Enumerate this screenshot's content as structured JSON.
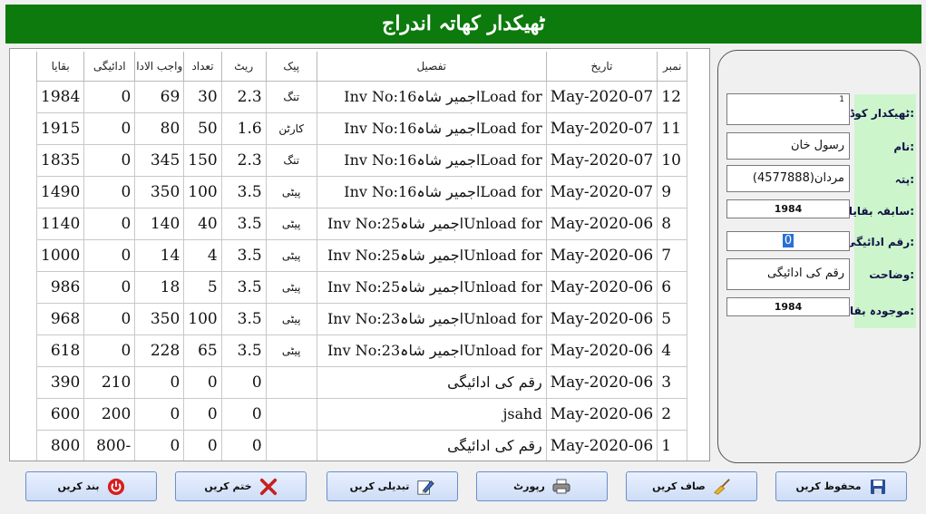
{
  "title": "ٹھیکدار کھاتہ اندراج",
  "grid": {
    "headers": {
      "no": "نمبر",
      "date": "تاریخ",
      "detail": "تفصیل",
      "pack": "پیک",
      "rate": "ریٹ",
      "qty": "تعداد",
      "due": "واجب الادا",
      "paid": "ادائیگی",
      "balance": "بقایا"
    },
    "rows": [
      {
        "no": "12",
        "date": "May-2020-07",
        "detail": "Inv No:16اجمیر شاہLoad for",
        "pack": "تنگ",
        "rate": "2.3",
        "qty": "30",
        "due": "69",
        "paid": "0",
        "balance": "1984"
      },
      {
        "no": "11",
        "date": "May-2020-07",
        "detail": "Inv No:16اجمیر شاہLoad for",
        "pack": "کارٹن",
        "rate": "1.6",
        "qty": "50",
        "due": "80",
        "paid": "0",
        "balance": "1915"
      },
      {
        "no": "10",
        "date": "May-2020-07",
        "detail": "Inv No:16اجمیر شاہLoad for",
        "pack": "تنگ",
        "rate": "2.3",
        "qty": "150",
        "due": "345",
        "paid": "0",
        "balance": "1835"
      },
      {
        "no": "9",
        "date": "May-2020-07",
        "detail": "Inv No:16اجمیر شاہLoad for",
        "pack": "پیٹی",
        "rate": "3.5",
        "qty": "100",
        "due": "350",
        "paid": "0",
        "balance": "1490"
      },
      {
        "no": "8",
        "date": "May-2020-06",
        "detail": "Inv No:25اجمیر شاہUnload for",
        "pack": "پیٹی",
        "rate": "3.5",
        "qty": "40",
        "due": "140",
        "paid": "0",
        "balance": "1140"
      },
      {
        "no": "7",
        "date": "May-2020-06",
        "detail": "Inv No:25اجمیر شاہUnload for",
        "pack": "پیٹی",
        "rate": "3.5",
        "qty": "4",
        "due": "14",
        "paid": "0",
        "balance": "1000"
      },
      {
        "no": "6",
        "date": "May-2020-06",
        "detail": "Inv No:25اجمیر شاہUnload for",
        "pack": "پیٹی",
        "rate": "3.5",
        "qty": "5",
        "due": "18",
        "paid": "0",
        "balance": "986"
      },
      {
        "no": "5",
        "date": "May-2020-06",
        "detail": "Inv No:23اجمیر شاہUnload for",
        "pack": "پیٹی",
        "rate": "3.5",
        "qty": "100",
        "due": "350",
        "paid": "0",
        "balance": "968"
      },
      {
        "no": "4",
        "date": "May-2020-06",
        "detail": "Inv No:23اجمیر شاہUnload for",
        "pack": "پیٹی",
        "rate": "3.5",
        "qty": "65",
        "due": "228",
        "paid": "0",
        "balance": "618"
      },
      {
        "no": "3",
        "date": "May-2020-06",
        "detail": "رقم کی ادائیگی",
        "pack": "",
        "rate": "0",
        "qty": "0",
        "due": "0",
        "paid": "210",
        "balance": "390"
      },
      {
        "no": "2",
        "date": "May-2020-06",
        "detail": "jsahd",
        "pack": "",
        "rate": "0",
        "qty": "0",
        "due": "0",
        "paid": "200",
        "balance": "600"
      },
      {
        "no": "1",
        "date": "May-2020-06",
        "detail": "رقم کی ادائیگی",
        "pack": "",
        "rate": "0",
        "qty": "0",
        "due": "0",
        "paid": "800-",
        "balance": "800"
      }
    ]
  },
  "form": {
    "labels": {
      "code": "ٹھیکدار کوڈ:",
      "name": "نام:",
      "address": "پتہ:",
      "prev_balance": "سابقہ بقایا:",
      "payment": "رقم ادائیگی:",
      "explanation": "وضاحت:",
      "current_balance": "موجودہ بقایا:"
    },
    "values": {
      "code": "1",
      "name": "رسول خان",
      "address": "مردان(4577888)",
      "prev_balance": "1984",
      "payment": "0",
      "explanation": "رقم کی ادائیگی",
      "current_balance": "1984"
    }
  },
  "buttons": {
    "save": "محفوظ کریں",
    "clear": "صاف کریں",
    "report": "رپورٹ",
    "edit": "تبدیلی کریں",
    "delete": "ختم کریں",
    "close": "بند کریں"
  },
  "colors": {
    "title_bar": "#0c7a0c",
    "label_panel": "#ccf5cc",
    "close_icon": "#d81e1e",
    "delete_icon": "#c62020"
  },
  "icons": {
    "save": "floppy-disk-icon",
    "clear": "broom-icon",
    "report": "printer-icon",
    "edit": "pencil-icon",
    "delete": "red-x-icon",
    "close": "power-icon"
  }
}
